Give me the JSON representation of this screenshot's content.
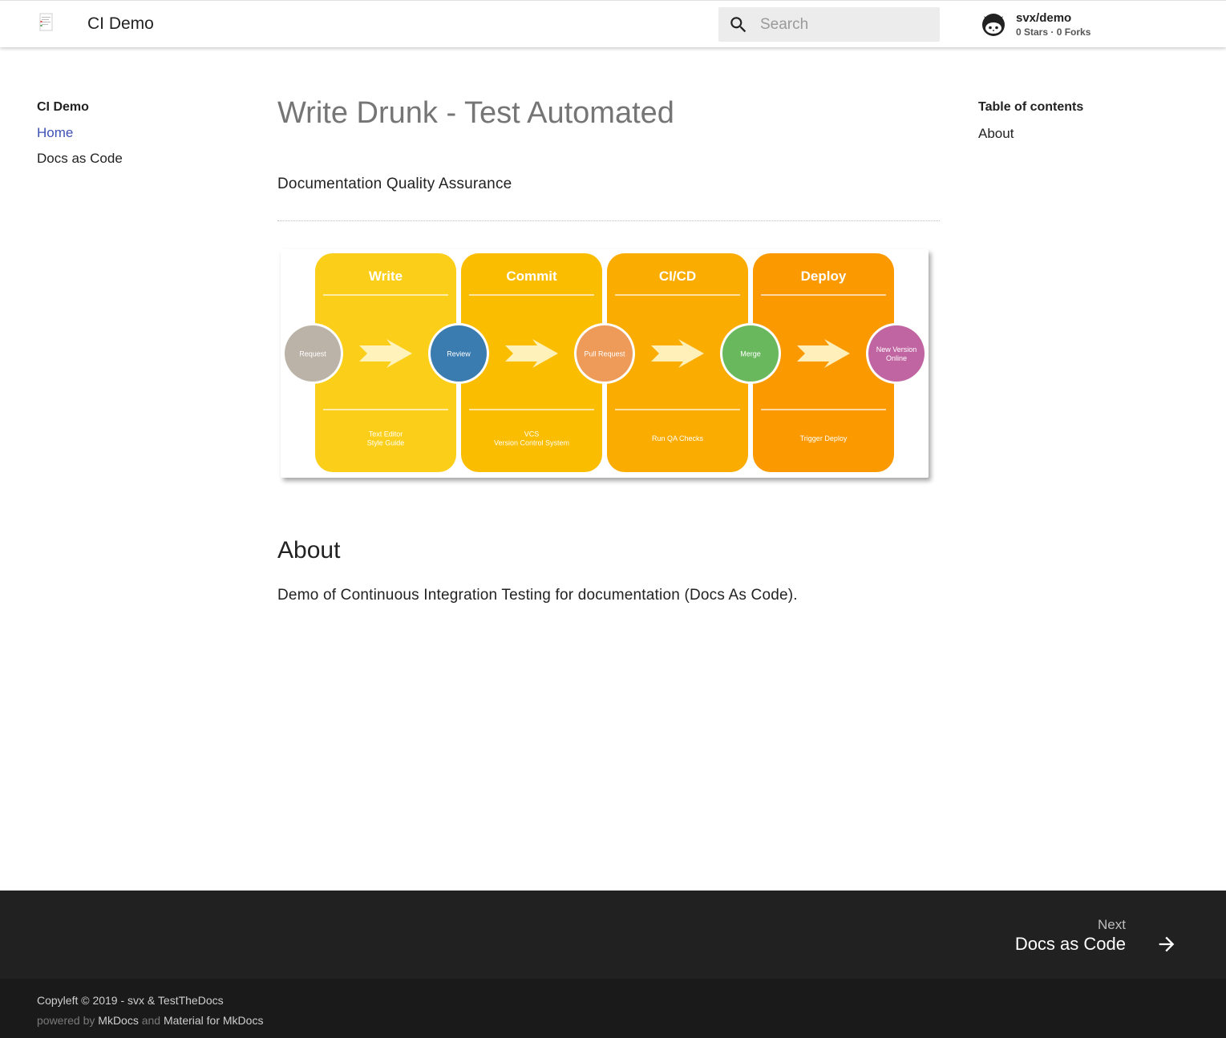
{
  "header": {
    "site_title": "CI Demo",
    "search_placeholder": "Search",
    "repo_name": "svx/demo",
    "repo_stats": "0 Stars · 0 Forks"
  },
  "nav": {
    "title": "CI Demo",
    "items": [
      {
        "label": "Home",
        "active": true
      },
      {
        "label": "Docs as Code",
        "active": false
      }
    ]
  },
  "toc": {
    "title": "Table of contents",
    "items": [
      "About"
    ]
  },
  "main": {
    "title": "Write Drunk - Test Automated",
    "subtitle": "Documentation Quality Assurance",
    "diagram": {
      "columns": [
        {
          "title": "Write",
          "color": "#fbcf19",
          "footer": [
            "Text Editor",
            "Style Guide"
          ]
        },
        {
          "title": "Commit",
          "color": "#fbbd00",
          "footer": [
            "VCS",
            "Version Control System"
          ]
        },
        {
          "title": "CI/CD",
          "color": "#fbac00",
          "footer": [
            "Run QA Checks"
          ]
        },
        {
          "title": "Deploy",
          "color": "#fb9900",
          "footer": [
            "Trigger Deploy"
          ]
        }
      ],
      "nodes": [
        {
          "label": [
            "Request"
          ],
          "color": "#bcb3a8"
        },
        {
          "label": [
            "Review"
          ],
          "color": "#3a7bb0"
        },
        {
          "label": [
            "Pull Request"
          ],
          "color": "#ee9a58"
        },
        {
          "label": [
            "Merge"
          ],
          "color": "#69b85e"
        },
        {
          "label": [
            "New Version",
            "Online"
          ],
          "color": "#c065a1"
        }
      ]
    },
    "about_heading": "About",
    "about_text": "Demo of Continuous Integration Testing for documentation (Docs As Code)."
  },
  "footer": {
    "next_label": "Next",
    "next_title": "Docs as Code",
    "copyright": "Copyleft © 2019 - svx & TestTheDocs",
    "powered_prefix": "powered by",
    "powered_mkdocs": "MkDocs",
    "powered_and": "and",
    "powered_material": "Material for MkDocs"
  }
}
